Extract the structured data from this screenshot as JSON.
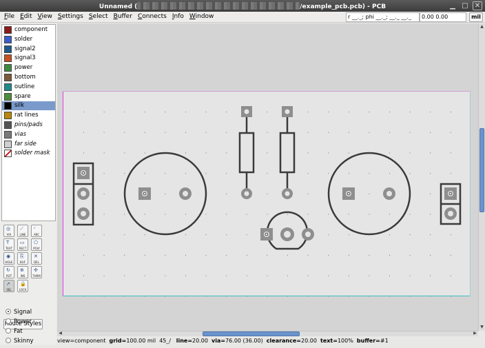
{
  "window": {
    "title_prefix": "Unnamed (",
    "title_suffix": "/example_pcb.pcb) - PCB",
    "minimize": "▁",
    "maximize": "□",
    "close": "✕"
  },
  "menubar": {
    "items": [
      {
        "mn": "F",
        "rest": "ile"
      },
      {
        "mn": "E",
        "rest": "dit"
      },
      {
        "mn": "V",
        "rest": "iew"
      },
      {
        "mn": "S",
        "rest": "ettings"
      },
      {
        "mn": "S",
        "rest": "elect"
      },
      {
        "mn": "B",
        "rest": "uffer"
      },
      {
        "mn": "C",
        "rest": "onnects"
      },
      {
        "mn": "I",
        "rest": "nfo"
      },
      {
        "mn": "W",
        "rest": "indow"
      }
    ],
    "coord_relative": "r __._; phi __._; __._ __._",
    "coord_absolute": "0.00 0.00",
    "unit": "mil"
  },
  "layers": [
    {
      "label": "component",
      "color": "#8b1a1a",
      "italic": false,
      "selected": false
    },
    {
      "label": "solder",
      "color": "#3a5fcd",
      "italic": false,
      "selected": false
    },
    {
      "label": "signal2",
      "color": "#1c5a8c",
      "italic": false,
      "selected": false
    },
    {
      "label": "signal3",
      "color": "#c8501e",
      "italic": false,
      "selected": false
    },
    {
      "label": "power",
      "color": "#3f8a3f",
      "italic": false,
      "selected": false
    },
    {
      "label": "bottom",
      "color": "#7a5a3a",
      "italic": false,
      "selected": false
    },
    {
      "label": "outline",
      "color": "#1e8a8a",
      "italic": false,
      "selected": false
    },
    {
      "label": "spare",
      "color": "#4c8c3a",
      "italic": false,
      "selected": false
    },
    {
      "label": "silk",
      "color": "#000000",
      "italic": false,
      "selected": true
    },
    {
      "label": "rat lines",
      "color": "#b8860b",
      "italic": false,
      "selected": false
    },
    {
      "label": "pins/pads",
      "color": "#555555",
      "italic": true,
      "selected": false
    },
    {
      "label": "vias",
      "color": "#7a7a7a",
      "italic": true,
      "selected": false
    },
    {
      "label": "far side",
      "color": "#cfcfcf",
      "italic": true,
      "selected": false
    },
    {
      "label": "solder mask",
      "color": "#ffffff",
      "italic": true,
      "selected": false
    }
  ],
  "tools": [
    {
      "label": "VIA",
      "icon": "via-icon",
      "glyph": "◎",
      "active": false
    },
    {
      "label": "LINE",
      "icon": "line-icon",
      "glyph": "⟋",
      "active": false
    },
    {
      "label": "ARC",
      "icon": "arc-icon",
      "glyph": "◜",
      "active": false
    },
    {
      "label": "TEXT",
      "icon": "text-icon",
      "glyph": "T",
      "active": false
    },
    {
      "label": "RECT",
      "icon": "rect-icon",
      "glyph": "▭",
      "active": false
    },
    {
      "label": "POLY",
      "icon": "poly-icon",
      "glyph": "⬠",
      "active": false
    },
    {
      "label": "HOLE",
      "icon": "hole-icon",
      "glyph": "◉",
      "active": false
    },
    {
      "label": "BUF",
      "icon": "buffer-icon",
      "glyph": "⎘",
      "active": false
    },
    {
      "label": "DEL",
      "icon": "delete-icon",
      "glyph": "✕",
      "active": false
    },
    {
      "label": "ROT",
      "icon": "rotate-icon",
      "glyph": "↻",
      "active": false
    },
    {
      "label": "INS",
      "icon": "insert-icon",
      "glyph": "⊕",
      "active": false
    },
    {
      "label": "THRM",
      "icon": "thermal-icon",
      "glyph": "✣",
      "active": false
    },
    {
      "label": "SEL",
      "icon": "select-icon",
      "glyph": "➚",
      "active": true
    },
    {
      "label": "LOCK",
      "icon": "lock-icon",
      "glyph": "🔒",
      "active": false
    }
  ],
  "route_styles": {
    "button_label": "Route Styles",
    "options": [
      {
        "label": "Signal",
        "checked": true
      },
      {
        "label": "Power",
        "checked": false
      },
      {
        "label": "Fat",
        "checked": false
      },
      {
        "label": "Skinny",
        "checked": false
      }
    ]
  },
  "status": {
    "view_key": "view=",
    "view_val": "component",
    "grid_key": "grid=",
    "grid_val": "100.00 mil",
    "angle": "45_/",
    "line_key": "line=",
    "line_val": "20.00",
    "via_key": "via=",
    "via_val": "76.00 (36.00)",
    "clearance_key": "clearance=",
    "clearance_val": "20.00",
    "text_key": "text=",
    "text_val": "100%",
    "buffer_key": "buffer=",
    "buffer_val": "#1"
  },
  "colors": {
    "canvas_bg": "#d4d4d4",
    "board_bg": "#e5e5e5",
    "board_edge_left": "#e040e0",
    "board_edge_bottom": "#40c0c0",
    "silk": "#3a3a3a",
    "pad": "#8e8e8e",
    "selection": "#7a9acb",
    "scroll_thumb": "#6b93cb"
  }
}
